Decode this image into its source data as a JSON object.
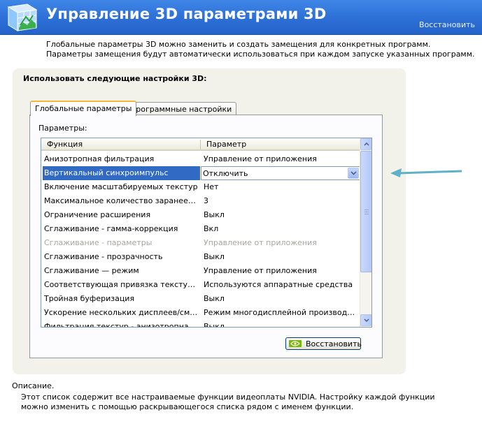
{
  "header": {
    "title": "Управление 3D параметрами 3D",
    "restore_link": "Восстановить"
  },
  "intro": "Глобальные параметры 3D можно заменить и создать замещения для конкретных программ. Параметры замещения будут автоматически использоваться при каждом запуске указанных программ.",
  "panel": {
    "title": "Использовать следующие настройки 3D:",
    "tabs": [
      {
        "label": "Глобальные параметры",
        "active": true
      },
      {
        "label": "Программные настройки",
        "active": false
      }
    ],
    "params_label": "Параметры:",
    "columns": [
      "Функция",
      "Параметр"
    ],
    "rows": [
      {
        "feature": "Анизотропная фильтрация",
        "value": "Управление от приложения",
        "state": "normal"
      },
      {
        "feature": "Вертикальный синхроимпульс",
        "value": "Отключить",
        "state": "selected"
      },
      {
        "feature": "Включение масштабируемых текстур",
        "value": "Нет",
        "state": "normal"
      },
      {
        "feature": "Максимальное количество заранее под...",
        "value": "3",
        "state": "normal"
      },
      {
        "feature": "Ограничение расширения",
        "value": "Выкл",
        "state": "normal"
      },
      {
        "feature": "Сглаживание - гамма-коррекция",
        "value": "Вкл",
        "state": "normal"
      },
      {
        "feature": "Сглаживание - параметры",
        "value": "Управление от приложения",
        "state": "disabled"
      },
      {
        "feature": "Сглаживание - прозрачность",
        "value": "Выкл",
        "state": "normal"
      },
      {
        "feature": "Сглаживание — режим",
        "value": "Управление от приложения",
        "state": "normal"
      },
      {
        "feature": "Соответствующая привязка текстуры",
        "value": "Используются аппаратные средства",
        "state": "normal"
      },
      {
        "feature": "Тройная буферизация",
        "value": "Выкл",
        "state": "normal"
      },
      {
        "feature": "Ускорение нескольких дисплеев/смеша...",
        "value": "Режим многодисплейной производител...",
        "state": "normal"
      },
      {
        "feature": "Фильтрация текстур - анизотропная оп...",
        "value": "Выкл",
        "state": "normal"
      }
    ],
    "restore_button": "Восстановить"
  },
  "description": {
    "label": "Описание.",
    "text": "Этот список содержит все настраиваемые функции видеоплаты NVIDIA. Настройку каждой функции можно изменить с помощью раскрывающегося списка рядом с именем функции."
  },
  "colors": {
    "header_blue": "#2c6fd6",
    "selection": "#316ac5",
    "arrow": "#5fb0c9",
    "nvidia_green": "#76b900"
  }
}
